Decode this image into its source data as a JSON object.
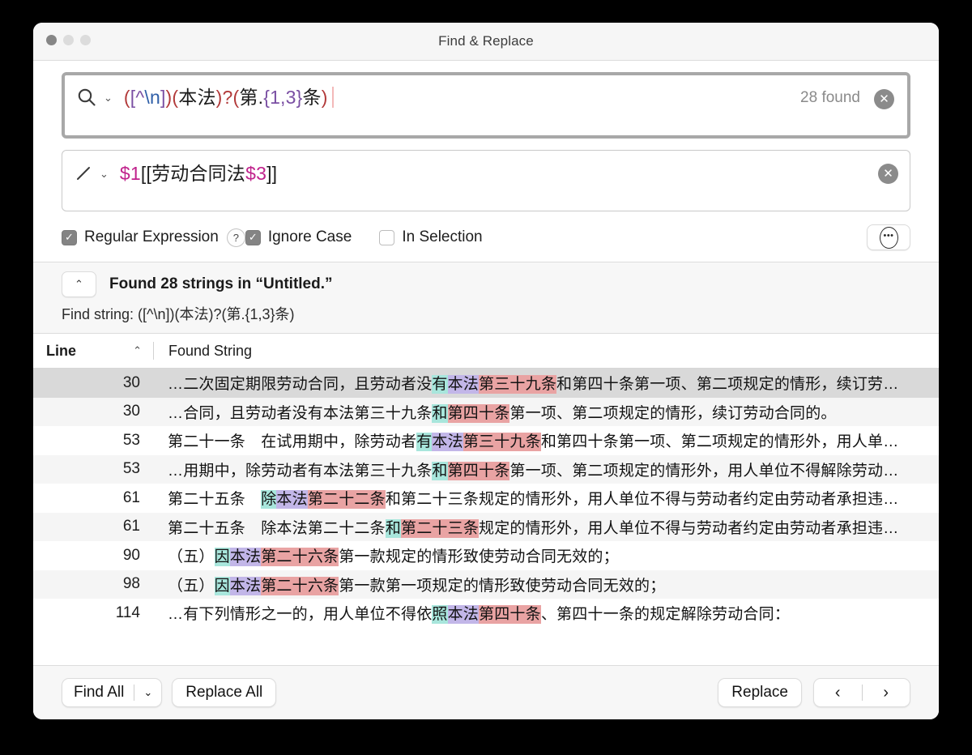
{
  "window": {
    "title": "Find & Replace",
    "traffic_lights": [
      "close-button",
      "minimize-button",
      "zoom-button"
    ]
  },
  "find_field": {
    "icon": "search-icon",
    "dropdown_icon": "chevron-down-icon",
    "value": "([^\\n])(本法)?(第.{1,3}条)",
    "tokens": [
      {
        "t": "(",
        "c": "re-paren"
      },
      {
        "t": "[",
        "c": "re-class"
      },
      {
        "t": "^",
        "c": "re-class"
      },
      {
        "t": "\\n",
        "c": "re-esc"
      },
      {
        "t": "]",
        "c": "re-class"
      },
      {
        "t": ")",
        "c": "re-paren"
      },
      {
        "t": "(",
        "c": "re-paren"
      },
      {
        "t": "本法",
        "c": "re-lit"
      },
      {
        "t": ")",
        "c": "re-paren"
      },
      {
        "t": "?",
        "c": "re-quant"
      },
      {
        "t": "(",
        "c": "re-paren"
      },
      {
        "t": "第",
        "c": "re-lit"
      },
      {
        "t": ".",
        "c": "re-lit"
      },
      {
        "t": "{1,3}",
        "c": "re-brace"
      },
      {
        "t": "条",
        "c": "re-lit"
      },
      {
        "t": ")",
        "c": "re-paren"
      }
    ],
    "count_label": "28 found",
    "clear_icon": "clear-circle-icon"
  },
  "replace_field": {
    "icon": "pencil-icon",
    "dropdown_icon": "chevron-down-icon",
    "value": "$1[[劳动合同法$3]]",
    "tokens": [
      {
        "t": "$1",
        "c": "re-dollar"
      },
      {
        "t": "[[劳动合同法",
        "c": "re-lit"
      },
      {
        "t": "$3",
        "c": "re-dollar"
      },
      {
        "t": "]]",
        "c": "re-lit"
      }
    ],
    "clear_icon": "clear-circle-icon"
  },
  "options": {
    "regular_expression": {
      "label": "Regular Expression",
      "checked": true,
      "check_glyph": "✓"
    },
    "help": {
      "label": "?",
      "name": "regex-help-button"
    },
    "ignore_case": {
      "label": "Ignore Case",
      "checked": true,
      "check_glyph": "✓"
    },
    "in_selection": {
      "label": "In Selection",
      "checked": false
    },
    "more_button": {
      "glyph": "•••",
      "name": "more-options-button"
    }
  },
  "results_header": {
    "collapse_glyph": "⌃",
    "title": "Found 28 strings in “Untitled.”",
    "subtitle": "Find string: ([^\\n])(本法)?(第.{1,3}条)"
  },
  "table": {
    "columns": {
      "line": "Line",
      "found": "Found String"
    },
    "sort_glyph": "⌃",
    "rows": [
      {
        "line": "30",
        "selected": true,
        "parts": [
          {
            "t": "…二次固定期限劳动合同，且劳动者没",
            "h": ""
          },
          {
            "t": "有",
            "h": "h1"
          },
          {
            "t": "本法",
            "h": "h2"
          },
          {
            "t": "第三十九条",
            "h": "h3"
          },
          {
            "t": "和第四十条第一项、第二项规定的情形，续订劳…",
            "h": "h4tail"
          }
        ]
      },
      {
        "line": "30",
        "selected": false,
        "parts": [
          {
            "t": "…合同，且劳动者没有本法第三十九条",
            "h": ""
          },
          {
            "t": "和",
            "h": "h1"
          },
          {
            "t": "第四十条",
            "h": "h3"
          },
          {
            "t": "第一项、第二项规定的情形，续订劳动合同的。",
            "h": "h4tail"
          }
        ]
      },
      {
        "line": "53",
        "selected": false,
        "parts": [
          {
            "t": "第二十一条　在试用期中，除劳动者",
            "h": ""
          },
          {
            "t": "有",
            "h": "h1"
          },
          {
            "t": "本法",
            "h": "h2"
          },
          {
            "t": "第三十九条",
            "h": "h3"
          },
          {
            "t": "和第四十条第一项、第二项规定的情形外，用人单…",
            "h": "h4tail"
          }
        ]
      },
      {
        "line": "53",
        "selected": false,
        "parts": [
          {
            "t": "…用期中，除劳动者有本法第三十九条",
            "h": ""
          },
          {
            "t": "和",
            "h": "h1"
          },
          {
            "t": "第四十条",
            "h": "h3"
          },
          {
            "t": "第一项、第二项规定的情形外，用人单位不得解除劳动…",
            "h": "h4tail"
          }
        ]
      },
      {
        "line": "61",
        "selected": false,
        "parts": [
          {
            "t": "第二十五条　",
            "h": ""
          },
          {
            "t": "除",
            "h": "h1"
          },
          {
            "t": "本法",
            "h": "h2"
          },
          {
            "t": "第二十二条",
            "h": "h3"
          },
          {
            "t": "和第二十三条规定的情形外，用人单位不得与劳动者约定由劳动者承担违…",
            "h": "h4tail"
          }
        ]
      },
      {
        "line": "61",
        "selected": false,
        "parts": [
          {
            "t": "第二十五条　除本法第二十二条",
            "h": ""
          },
          {
            "t": "和",
            "h": "h1"
          },
          {
            "t": "第二十三条",
            "h": "h3"
          },
          {
            "t": "规定的情形外，用人单位不得与劳动者约定由劳动者承担违…",
            "h": "h4tail"
          }
        ]
      },
      {
        "line": "90",
        "selected": false,
        "parts": [
          {
            "t": "（五）",
            "h": ""
          },
          {
            "t": "因",
            "h": "h1"
          },
          {
            "t": "本法",
            "h": "h2"
          },
          {
            "t": "第二十六条",
            "h": "h3"
          },
          {
            "t": "第一款规定的情形致使劳动合同无效的；",
            "h": "h4tail"
          }
        ]
      },
      {
        "line": "98",
        "selected": false,
        "parts": [
          {
            "t": "（五）",
            "h": ""
          },
          {
            "t": "因",
            "h": "h1"
          },
          {
            "t": "本法",
            "h": "h2"
          },
          {
            "t": "第二十六条",
            "h": "h3"
          },
          {
            "t": "第一款第一项规定的情形致使劳动合同无效的；",
            "h": "h4tail"
          }
        ]
      },
      {
        "line": "114",
        "selected": false,
        "parts": [
          {
            "t": "…有下列情形之一的，用人单位不得依",
            "h": ""
          },
          {
            "t": "照",
            "h": "h1"
          },
          {
            "t": "本法",
            "h": "h2"
          },
          {
            "t": "第四十条",
            "h": "h3"
          },
          {
            "t": "、第四十一条的规定解除劳动合同：",
            "h": "h4tail"
          }
        ]
      }
    ]
  },
  "footer": {
    "find_all": "Find All",
    "find_all_arrow": "⌄",
    "replace_all": "Replace All",
    "replace": "Replace",
    "prev_glyph": "‹",
    "next_glyph": "›"
  },
  "colors": {
    "highlight_group1": "#a8e6dc",
    "highlight_group2": "#c2b6e8",
    "highlight_group3": "#e9a3a3",
    "highlight_match_bg": "#f2c3c3",
    "regex_paren": "#b23a3a",
    "regex_class": "#7a4fa3",
    "regex_escape": "#2f5fa8",
    "replace_var": "#c0228c",
    "selected_row": "#d9d9d9"
  }
}
